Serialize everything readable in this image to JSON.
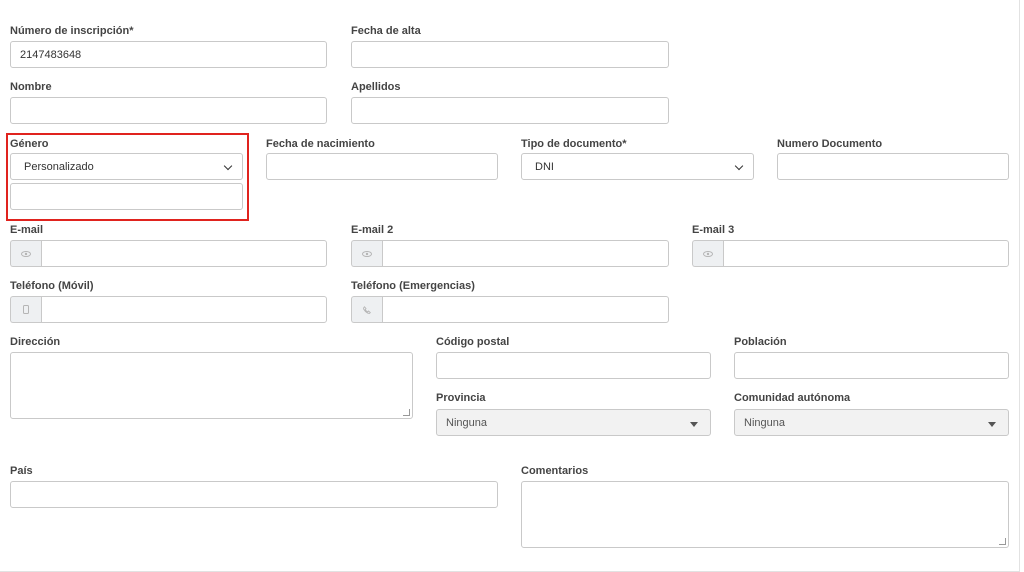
{
  "fields": {
    "inscripcion": {
      "label": "Número de inscripción*",
      "value": "2147483648"
    },
    "fecha_alta": {
      "label": "Fecha de alta",
      "value": ""
    },
    "nombre": {
      "label": "Nombre",
      "value": ""
    },
    "apellidos": {
      "label": "Apellidos",
      "value": ""
    },
    "genero": {
      "label": "Género",
      "value": "Personalizado",
      "custom_value": ""
    },
    "fecha_nacimiento": {
      "label": "Fecha de nacimiento",
      "value": ""
    },
    "tipo_documento": {
      "label": "Tipo de documento*",
      "value": "DNI"
    },
    "numero_documento": {
      "label": "Numero Documento",
      "value": ""
    },
    "email": {
      "label": "E-mail",
      "value": ""
    },
    "email2": {
      "label": "E-mail 2",
      "value": ""
    },
    "email3": {
      "label": "E-mail 3",
      "value": ""
    },
    "telefono_movil": {
      "label": "Teléfono (Móvil)",
      "value": ""
    },
    "telefono_emergencias": {
      "label": "Teléfono (Emergencias)",
      "value": ""
    },
    "direccion": {
      "label": "Dirección",
      "value": ""
    },
    "codigo_postal": {
      "label": "Código postal",
      "value": ""
    },
    "poblacion": {
      "label": "Población",
      "value": ""
    },
    "provincia": {
      "label": "Provincia",
      "value": "Ninguna"
    },
    "comunidad": {
      "label": "Comunidad autónoma",
      "value": "Ninguna"
    },
    "pais": {
      "label": "País",
      "value": ""
    },
    "comentarios": {
      "label": "Comentarios",
      "value": ""
    }
  },
  "icons": {
    "email": "eye-icon",
    "mobile": "mobile-phone-icon",
    "phone": "phone-icon"
  },
  "colors": {
    "highlight": "#e0231e",
    "border": "#c9c9c9",
    "addon_bg": "#eef0f2"
  }
}
